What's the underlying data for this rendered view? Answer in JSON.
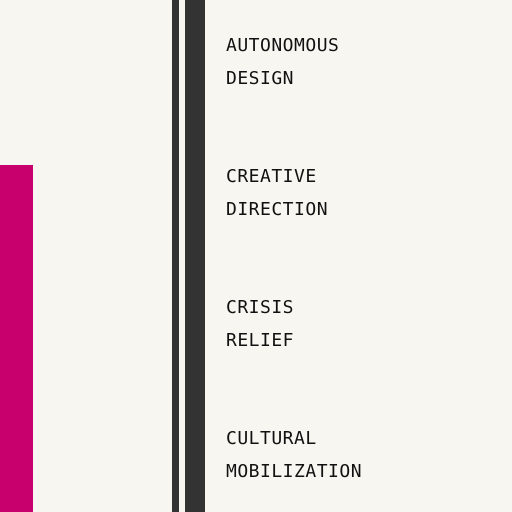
{
  "colors": {
    "background": "#f7f6f0",
    "accent": "#c8006e",
    "rule": "#333333",
    "text": "#111111"
  },
  "menu": {
    "items": [
      {
        "line1": "AUTONOMOUS",
        "line2": "DESIGN"
      },
      {
        "line1": "CREATIVE",
        "line2": "DIRECTION"
      },
      {
        "line1": "CRISIS",
        "line2": "RELIEF"
      },
      {
        "line1": "CULTURAL",
        "line2": "MOBILIZATION"
      }
    ]
  }
}
